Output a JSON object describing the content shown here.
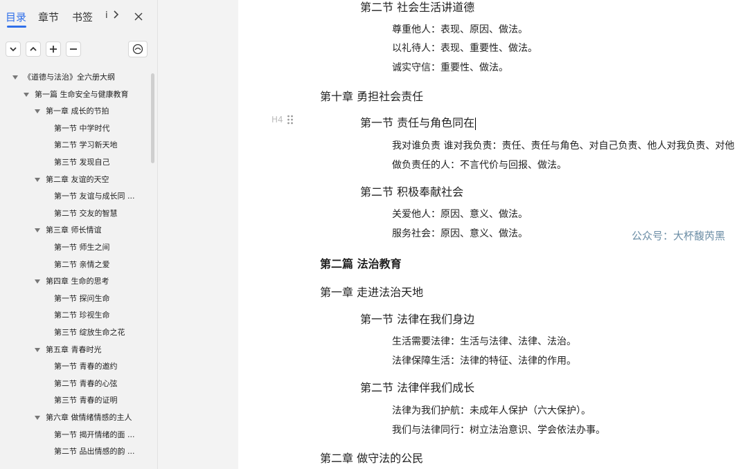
{
  "sidebar": {
    "tabs": [
      "目录",
      "章节",
      "书签",
      "i"
    ],
    "toolbar": {
      "collapse": "⌄",
      "expand": "⌃",
      "add": "+",
      "remove": "−"
    },
    "tree": [
      {
        "text": "《道德与法治》全六册大纲",
        "level": 0,
        "caret": true
      },
      {
        "text": "第一篇 生命安全与健康教育",
        "level": 1,
        "caret": true
      },
      {
        "text": "第一章 成长的节拍",
        "level": 2,
        "caret": true
      },
      {
        "text": "第一节 中学时代",
        "level": 3,
        "caret": false
      },
      {
        "text": "第二节 学习新天地",
        "level": 3,
        "caret": false
      },
      {
        "text": "第三节 发现自己",
        "level": 3,
        "caret": false
      },
      {
        "text": "第二章 友谊的天空",
        "level": 2,
        "caret": true
      },
      {
        "text": "第一节 友谊与成长同 ...",
        "level": 3,
        "caret": false
      },
      {
        "text": "第二节 交友的智慧",
        "level": 3,
        "caret": false
      },
      {
        "text": "第三章 师长情谊",
        "level": 2,
        "caret": true
      },
      {
        "text": "第一节 师生之间",
        "level": 3,
        "caret": false
      },
      {
        "text": "第二节 亲情之爱",
        "level": 3,
        "caret": false
      },
      {
        "text": "第四章 生命的思考",
        "level": 2,
        "caret": true
      },
      {
        "text": "第一节 探问生命",
        "level": 3,
        "caret": false
      },
      {
        "text": "第二节 珍视生命",
        "level": 3,
        "caret": false
      },
      {
        "text": "第三节 绽放生命之花",
        "level": 3,
        "caret": false
      },
      {
        "text": "第五章 青春时光",
        "level": 2,
        "caret": true
      },
      {
        "text": "第一节 青春的邀约",
        "level": 3,
        "caret": false
      },
      {
        "text": "第二节 青春的心弦",
        "level": 3,
        "caret": false
      },
      {
        "text": "第三节 青春的证明",
        "level": 3,
        "caret": false
      },
      {
        "text": "第六章 做情绪情感的主人",
        "level": 2,
        "caret": true
      },
      {
        "text": "第一节 揭开情绪的面 ...",
        "level": 3,
        "caret": false
      },
      {
        "text": "第二节 品出情感的韵 ...",
        "level": 3,
        "caret": false
      }
    ]
  },
  "doc": {
    "h4_marker": "H4",
    "watermark": "公众号：大杯馥芮黑",
    "lines": [
      {
        "text": "第二节  社会生活讲道德",
        "kind": "h4"
      },
      {
        "text": "尊重他人：表现、原因、做法。",
        "kind": "item"
      },
      {
        "text": "以礼待人：表现、重要性、做法。",
        "kind": "item"
      },
      {
        "text": "诚实守信：重要性、做法。",
        "kind": "item"
      },
      {
        "text": "第十章  勇担社会责任",
        "kind": "h3"
      },
      {
        "text": "第一节  责任与角色同在",
        "kind": "h4",
        "cursor": true
      },
      {
        "text": "我对谁负责  谁对我负责：责任、责任与角色、对自己负责、他人对我负责、对他",
        "kind": "item"
      },
      {
        "text": "做负责任的人：不言代价与回报、做法。",
        "kind": "item"
      },
      {
        "text": "第二节  积极奉献社会",
        "kind": "h4"
      },
      {
        "text": "关爱他人：原因、意义、做法。",
        "kind": "item"
      },
      {
        "text": "服务社会：原因、意义、做法。",
        "kind": "item"
      },
      {
        "text": "第二篇  法治教育",
        "kind": "part"
      },
      {
        "text": "第一章  走进法治天地",
        "kind": "h3"
      },
      {
        "text": "第一节  法律在我们身边",
        "kind": "h4"
      },
      {
        "text": "生活需要法律：生活与法律、法律、法治。",
        "kind": "item"
      },
      {
        "text": "法律保障生活：法律的特征、法律的作用。",
        "kind": "item"
      },
      {
        "text": "第二节  法律伴我们成长",
        "kind": "h4"
      },
      {
        "text": "法律为我们护航：未成年人保护（六大保护）。",
        "kind": "item"
      },
      {
        "text": "我们与法律同行：树立法治意识、学会依法办事。",
        "kind": "item"
      },
      {
        "text": "第二章  做守法的公民",
        "kind": "h3"
      }
    ]
  }
}
